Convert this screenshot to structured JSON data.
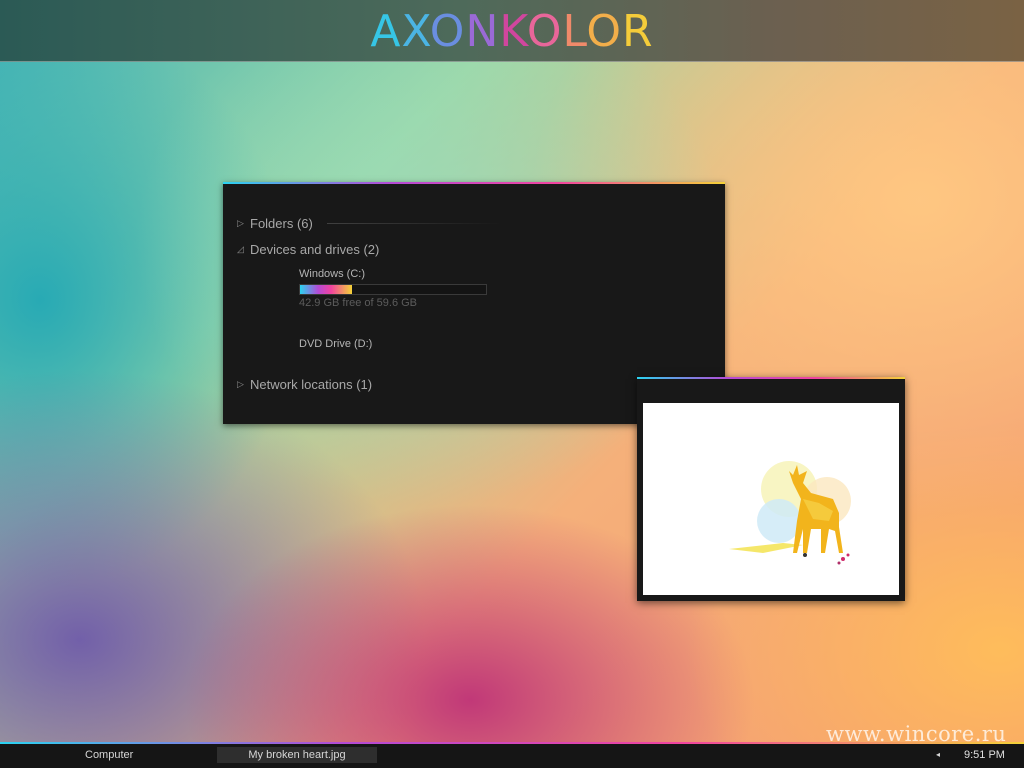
{
  "header": {
    "logo_letters": [
      {
        "char": "A",
        "color": "#36c6e6"
      },
      {
        "char": "X",
        "color": "#4bb4e4"
      },
      {
        "char": "O",
        "color": "#6a8ee0"
      },
      {
        "char": "N",
        "color": "#9a6ad6"
      },
      {
        "char": "K",
        "color": "#d0469e"
      },
      {
        "char": "O",
        "color": "#e8669a"
      },
      {
        "char": "L",
        "color": "#f08a6a"
      },
      {
        "char": "O",
        "color": "#f2ae4a"
      },
      {
        "char": "R",
        "color": "#f4cc3a"
      }
    ]
  },
  "explorer": {
    "groups": [
      {
        "arrow": "▷",
        "label": "Folders (6)"
      },
      {
        "arrow": "◿",
        "label": "Devices and drives (2)"
      },
      {
        "arrow": "▷",
        "label": "Network locations (1)"
      }
    ],
    "drives": [
      {
        "name": "Windows (C:)",
        "free_text": "42.9 GB free of 59.6 GB",
        "used_fraction": 0.28
      },
      {
        "name": "DVD Drive (D:)"
      }
    ],
    "icons": {
      "collapsed": "triangle-right-icon",
      "expanded": "triangle-down-right-icon"
    }
  },
  "viewer": {
    "image_subject": "deer-illustration",
    "accent": "#c2205a"
  },
  "taskbar": {
    "computer_label": "Computer",
    "image_label": "My broken heart.jpg",
    "tray_arrow": "◂",
    "clock": "9:51 PM"
  },
  "watermark": "www.wincore.ru",
  "colors": {
    "rainbow": [
      "#2bd3f0",
      "#b44bd6",
      "#f1449f",
      "#f4d238"
    ],
    "panel": "#181818",
    "taskbar": "#151515"
  }
}
